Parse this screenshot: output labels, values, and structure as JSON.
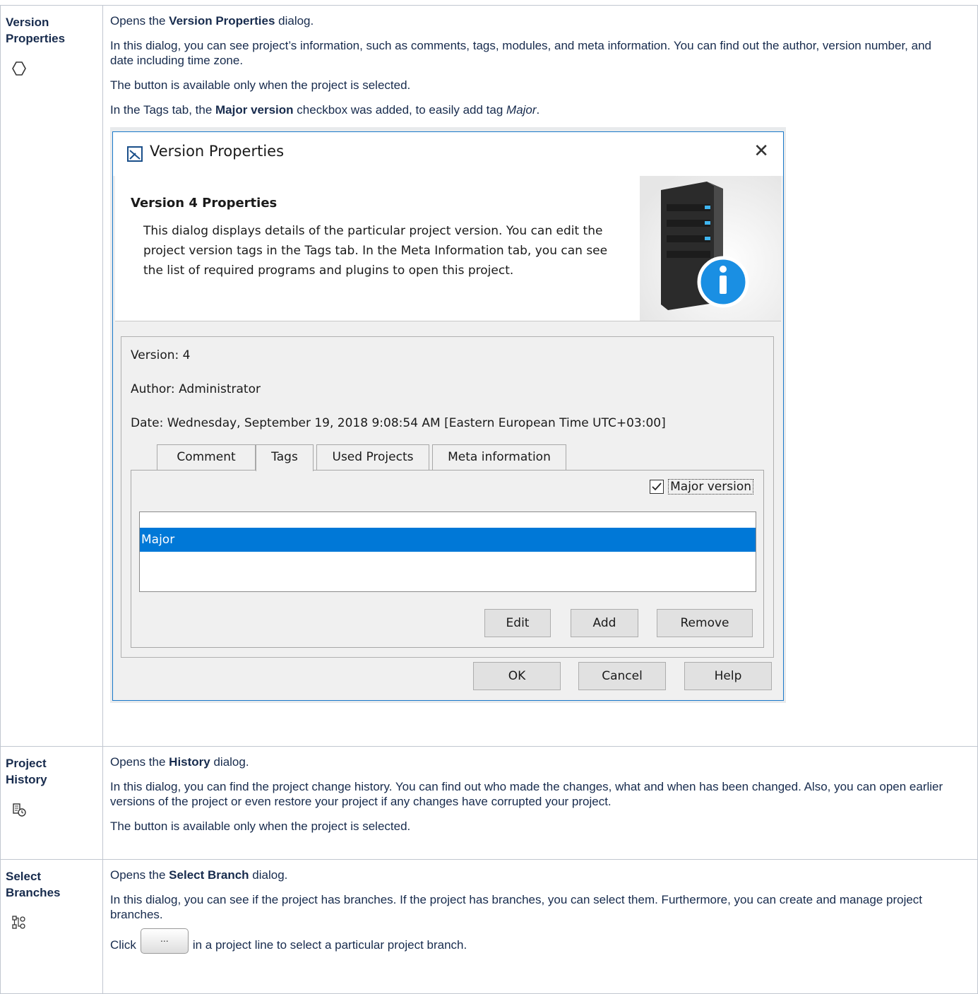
{
  "rows": [
    {
      "name": "Version Properties",
      "icon": "hexagon-outline-icon",
      "p1_pre": "Opens the ",
      "p1_bold": "Version Properties",
      "p1_post": " dialog.",
      "p2": "In this dialog, you can see project’s information, such as comments, tags, modules, and meta information. You can find out the author, version number, and date including time zone.",
      "p3": "The button is available only when the project is selected.",
      "p4_pre": "In the Tags tab, the ",
      "p4_bold": "Major version",
      "p4_mid": " checkbox was added, to easily add tag ",
      "p4_italic": "Major",
      "p4_post": "."
    },
    {
      "name": "Project History",
      "icon": "history-icon",
      "p1_pre": "Opens the ",
      "p1_bold": "History",
      "p1_post": " dialog.",
      "p2": "In this dialog, you can find the project change history. You can find out who made the changes, what and when has been changed. Also, you can open earlier versions of the project or even restore your project if any changes have corrupted your project.",
      "p3": "The button is available only when the project is selected."
    },
    {
      "name": "Select Branches",
      "icon": "branches-icon",
      "p1_pre": "Opens the ",
      "p1_bold": "Select Branch",
      "p1_post": " dialog.",
      "p2": "In this dialog, you can see if the project has branches. If the project has branches, you can select them. Furthermore, you can create and manage project branches.",
      "p3_pre": "Click",
      "p3_button": "...",
      "p3_post": "in a project line to select a particular project branch."
    }
  ],
  "dialog": {
    "title": "Version Properties",
    "close_label": "✕",
    "banner_title": "Version 4 Properties",
    "banner_text": "This dialog displays details of the particular project version. You can edit the project version tags in the Tags tab. In the Meta Information tab, you can see the list of required programs and plugins to open this project.",
    "version": "Version: 4",
    "author": "Author: Administrator",
    "date": "Date: Wednesday, September 19, 2018 9:08:54 AM [Eastern European Time UTC+03:00]",
    "tabs": [
      "Comment",
      "Tags",
      "Used Projects",
      "Meta information"
    ],
    "active_tab": "Tags",
    "checkbox_label": "Major version",
    "checkbox_checked": true,
    "tag_items": [
      "Major"
    ],
    "tag_buttons": [
      "Edit",
      "Add",
      "Remove"
    ],
    "footer_buttons": [
      "OK",
      "Cancel",
      "Help"
    ],
    "colors": {
      "selection": "#0078d7",
      "title_border": "#1979ca",
      "info_badge": "#1a8fe3"
    }
  }
}
